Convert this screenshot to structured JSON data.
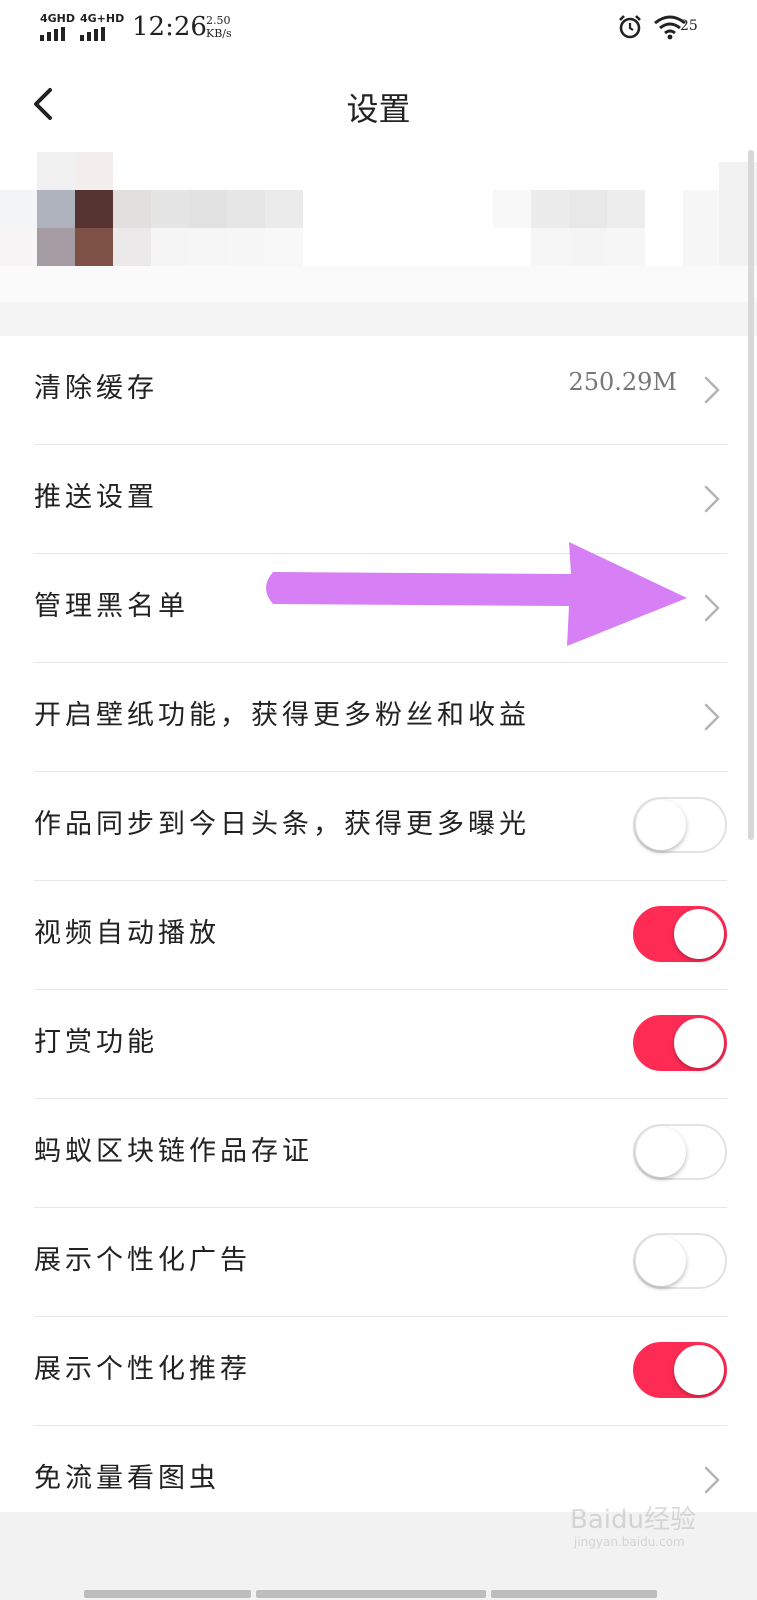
{
  "status_bar": {
    "signal1_label": "4GHD",
    "signal2_label": "4G+HD",
    "time": "12:26",
    "speed_value": "2.50",
    "speed_unit": "KB/s",
    "battery": "25"
  },
  "header": {
    "title": "设置"
  },
  "settings": [
    {
      "label": "清除缓存",
      "value": "250.29M",
      "type": "arrow"
    },
    {
      "label": "推送设置",
      "type": "arrow"
    },
    {
      "label": "管理黑名单",
      "type": "arrow"
    },
    {
      "label": "开启壁纸功能，获得更多粉丝和收益",
      "type": "arrow"
    },
    {
      "label": "作品同步到今日头条，获得更多曝光",
      "type": "toggle",
      "on": false
    },
    {
      "label": "视频自动播放",
      "type": "toggle",
      "on": true
    },
    {
      "label": "打赏功能",
      "type": "toggle",
      "on": true
    },
    {
      "label": "蚂蚁区块链作品存证",
      "type": "toggle",
      "on": false
    },
    {
      "label": "展示个性化广告",
      "type": "toggle",
      "on": false
    },
    {
      "label": "展示个性化推荐",
      "type": "toggle",
      "on": true
    },
    {
      "label": "免流量看图虫",
      "type": "arrow"
    }
  ],
  "colors": {
    "toggle_on": "#fe2c55",
    "annotation_arrow": "#d77ff5"
  },
  "watermark": {
    "text": "Baidu经验",
    "subtext": "jingyan.baidu.com"
  }
}
